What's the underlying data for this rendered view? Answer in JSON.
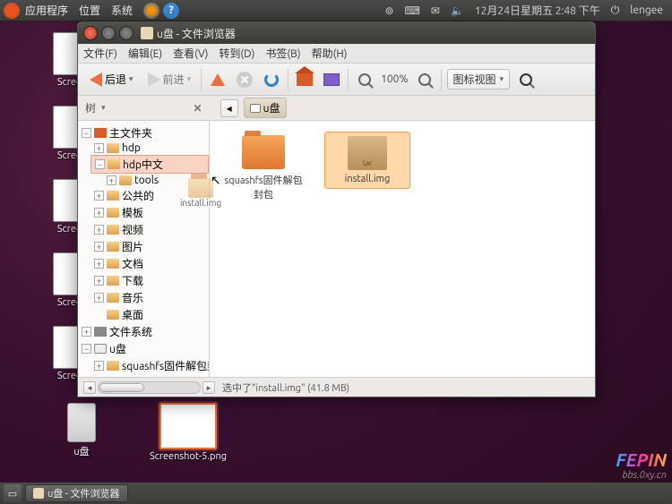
{
  "top_panel": {
    "menu_apps": "应用程序",
    "menu_places": "位置",
    "menu_system": "系统",
    "datetime": "12月24日星期五 2:48 下午",
    "user": "lengee"
  },
  "desktop": {
    "icon1": "Screens",
    "icon2": "Screens",
    "icon3": "Screens",
    "icon4": "Screens",
    "icon5": "Screens",
    "usb": "u盘",
    "shot5": "Screenshot-5.png"
  },
  "window": {
    "title": "u盘 - 文件浏览器",
    "menu": {
      "file": "文件(F)",
      "edit": "编辑(E)",
      "view": "查看(V)",
      "go": "转到(D)",
      "bookmarks": "书签(B)",
      "help": "帮助(H)"
    },
    "toolbar": {
      "back": "后退",
      "forward": "前进",
      "zoom": "100%",
      "view_mode": "图标视图"
    },
    "location": {
      "tree_label": "树",
      "loc_crumb": "u盘"
    },
    "tree": {
      "home": "主文件夹",
      "hdp": "hdp",
      "hdp_cn": "hdp中文",
      "tools": "tools",
      "public": "公共的",
      "templates": "模板",
      "videos": "视频",
      "pictures": "图片",
      "documents": "文档",
      "downloads": "下载",
      "music": "音乐",
      "desktop": "桌面",
      "filesystem": "文件系统",
      "udisk": "u盘",
      "squashfs": "squashfs固件解包封包"
    },
    "main": {
      "item1": "squashfs固件解包封包",
      "item2": "install.img",
      "pkg_label": "tar"
    },
    "drag_ghost": "install.img",
    "statusbar": "选中了\"install.img\" (41.8 MB)"
  },
  "taskbar": {
    "app": "u盘 - 文件浏览器"
  },
  "watermark": {
    "brand": "FEPIN",
    "sub": "bbs.0xy.cn"
  }
}
